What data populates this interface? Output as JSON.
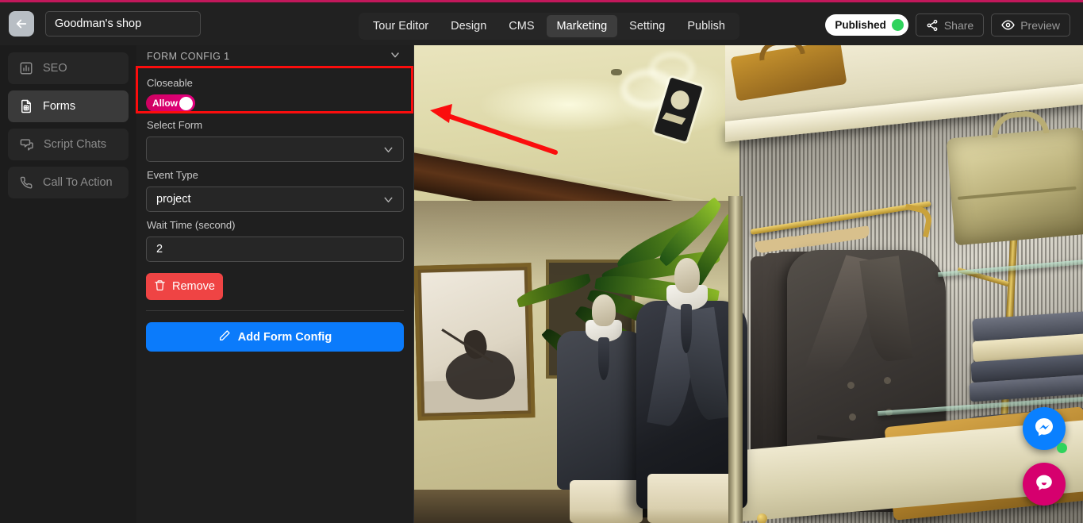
{
  "topbar": {
    "back_icon": "arrow-left-icon",
    "project_title": "Goodman's shop",
    "tabs": [
      {
        "label": "Tour Editor",
        "active": false
      },
      {
        "label": "Design",
        "active": false
      },
      {
        "label": "CMS",
        "active": false
      },
      {
        "label": "Marketing",
        "active": true
      },
      {
        "label": "Setting",
        "active": false
      },
      {
        "label": "Publish",
        "active": false
      }
    ],
    "status_badge": {
      "label": "Published",
      "dot_color": "#2fd35c"
    },
    "share_label": "Share",
    "share_icon": "share-nodes-icon",
    "preview_label": "Preview",
    "preview_icon": "eye-icon"
  },
  "sidebar": {
    "items": [
      {
        "label": "SEO",
        "icon": "chart-bar-icon",
        "active": false
      },
      {
        "label": "Forms",
        "icon": "document-form-icon",
        "active": true
      },
      {
        "label": "Script Chats",
        "icon": "chat-bubbles-icon",
        "active": false
      },
      {
        "label": "Call To Action",
        "icon": "phone-icon",
        "active": false
      }
    ]
  },
  "panel": {
    "header": "FORM CONFIG 1",
    "header_icon": "chevron-down-icon",
    "closeable_label": "Closeable",
    "closeable_toggle": {
      "label": "Allow",
      "state": "on",
      "color": "#e4007f"
    },
    "select_form_label": "Select Form",
    "select_form_value": "",
    "event_type_label": "Event Type",
    "event_type_value": "project",
    "wait_time_label": "Wait Time (second)",
    "wait_time_value": "2",
    "remove_label": "Remove",
    "remove_icon": "trash-icon",
    "remove_color": "#ef4444",
    "add_label": "Add Form Config",
    "add_icon": "pencil-icon",
    "add_color": "#0b7bfb"
  },
  "annotation": {
    "highlight_color": "#fb0d0d",
    "arrow_color": "#fb0d0d"
  },
  "widgets": {
    "messenger": {
      "icon": "messenger-icon",
      "color": "#0a80ff",
      "online_dot": "#2fd35c"
    },
    "chat": {
      "icon": "chat-bubble-icon",
      "color": "#d6006e"
    }
  }
}
